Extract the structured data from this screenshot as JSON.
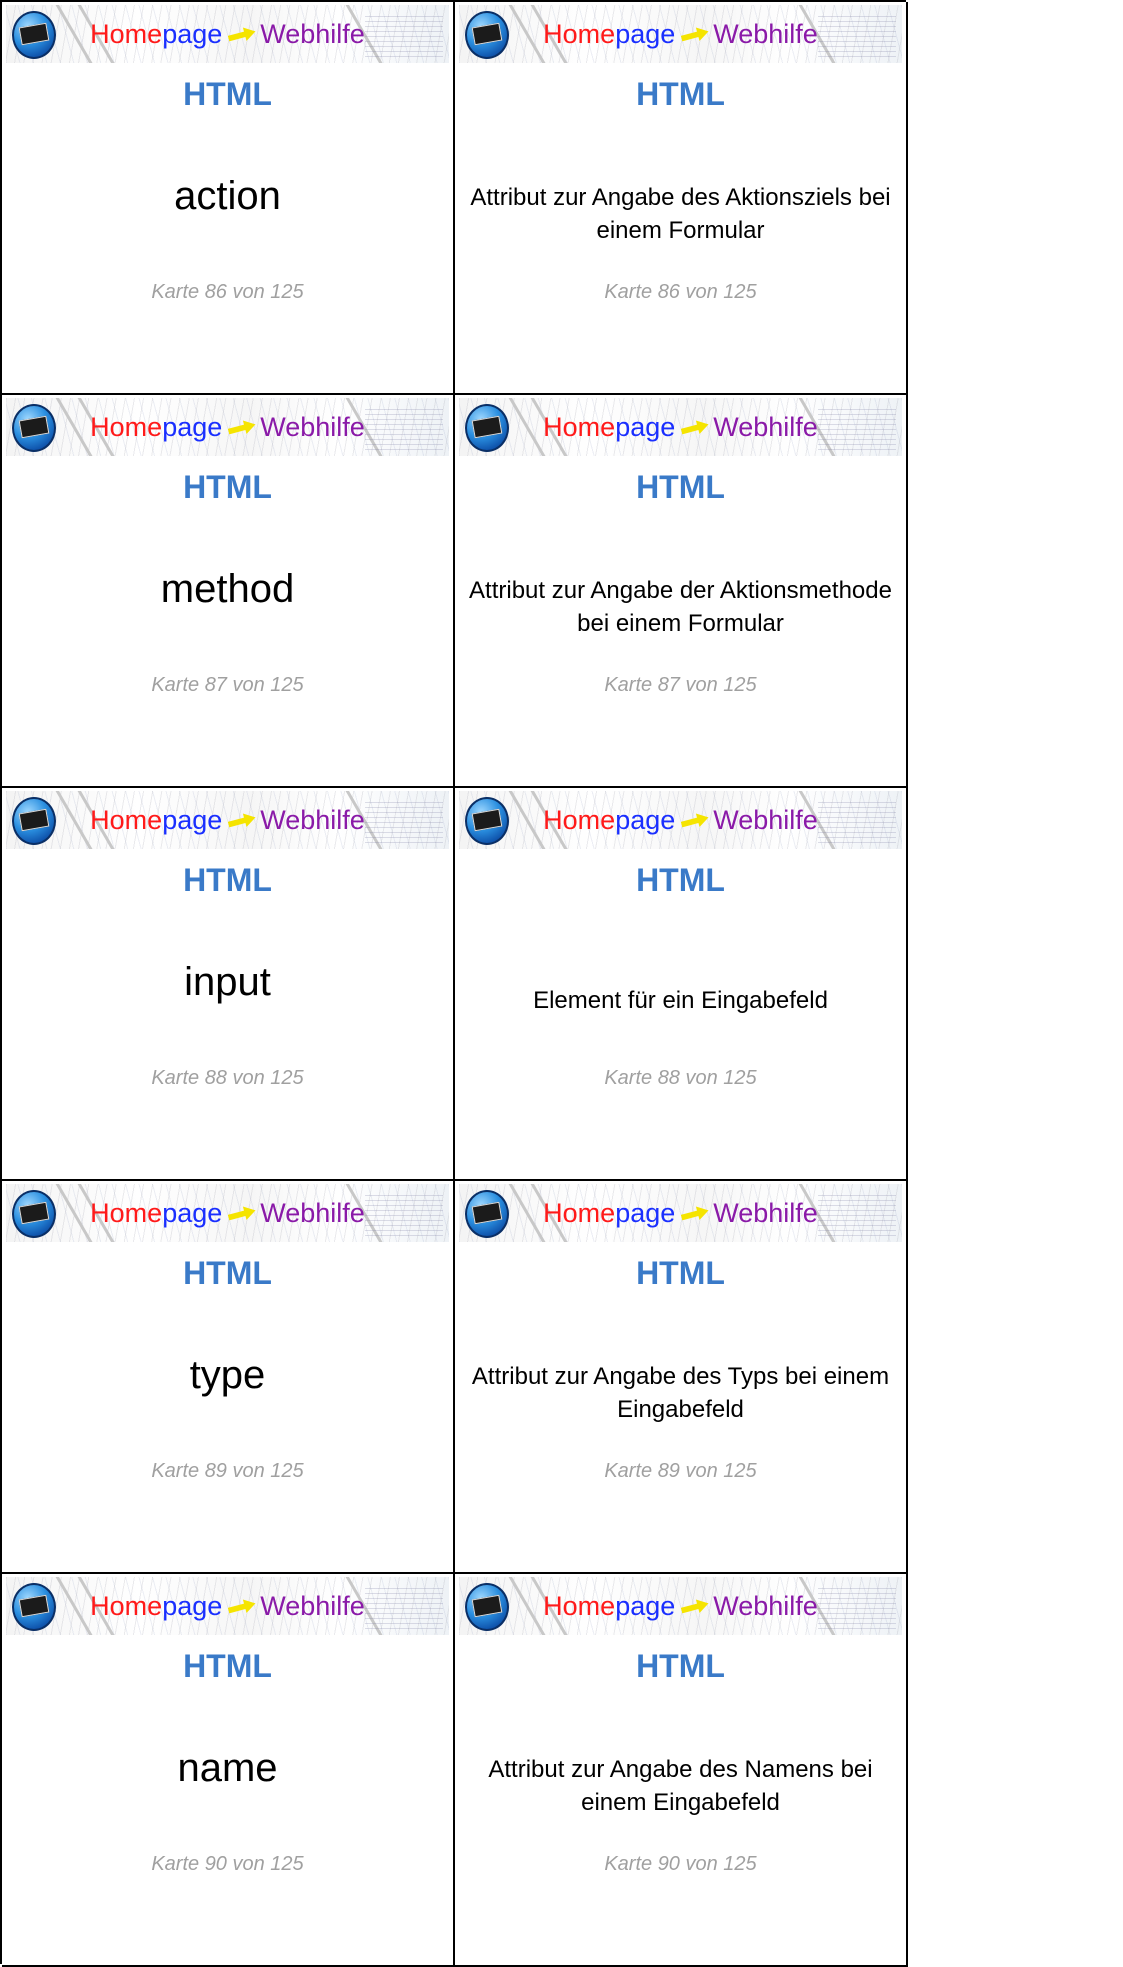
{
  "banner": {
    "brand_part1": "Home",
    "brand_part2": "page",
    "brand_part3": "Webhilfe",
    "colors": {
      "home": "#ff1a1a",
      "page": "#1a2fff",
      "arrow": "#f5e400",
      "web": "#8a1aa8"
    }
  },
  "subject_color": "#3a7ac8",
  "cards": [
    {
      "subject": "HTML",
      "term": "action",
      "definition": "Attribut zur Angabe des Aktionsziels bei einem Formular",
      "counter": "Karte 86 von 125"
    },
    {
      "subject": "HTML",
      "term": "method",
      "definition": "Attribut zur Angabe der Aktionsmethode bei einem Formular",
      "counter": "Karte 87 von 125"
    },
    {
      "subject": "HTML",
      "term": "input",
      "definition": "Element für ein Eingabefeld",
      "counter": "Karte 88 von 125"
    },
    {
      "subject": "HTML",
      "term": "type",
      "definition": "Attribut zur Angabe des Typs bei einem Eingabefeld",
      "counter": "Karte 89 von 125"
    },
    {
      "subject": "HTML",
      "term": "name",
      "definition": "Attribut zur Angabe des Namens bei einem Eingabefeld",
      "counter": "Karte 90 von 125"
    }
  ]
}
